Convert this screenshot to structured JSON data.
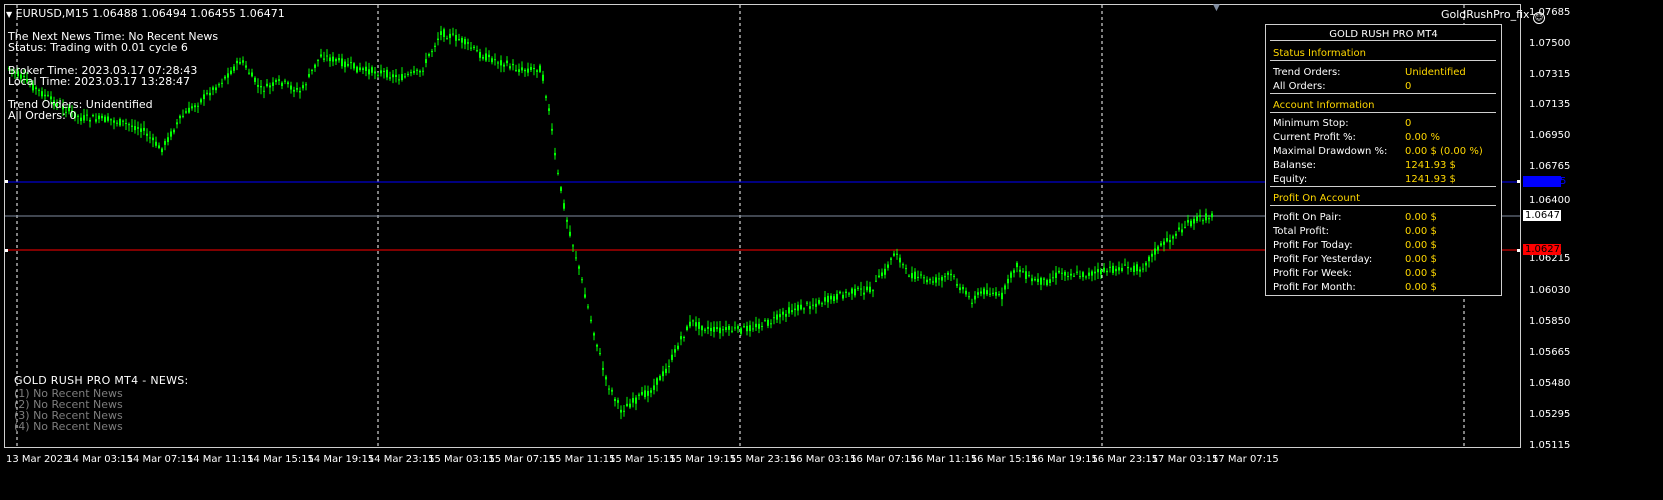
{
  "header": {
    "symbol_info": "EURUSD,M15  1.06488 1.06494 1.06455 1.06471",
    "expert_name": "GoldRushPro_fix"
  },
  "info_block": {
    "line1": "The Next News Time: No Recent News",
    "line2": "Status: Trading with 0.01 cycle 6",
    "line3": "Broker Time: 2023.03.17 07:28:43",
    "line4": "Local Time: 2023.03.17 13:28:47",
    "line5": "Trend Orders: Unidentified",
    "line6": "All Orders: 0"
  },
  "news": {
    "title": "GOLD RUSH PRO MT4 - NEWS:",
    "items": [
      "(1)  No Recent News",
      "(2)  No Recent News",
      "(3)  No Recent News",
      "(4)  No Recent News"
    ]
  },
  "panel": {
    "title": "GOLD RUSH PRO MT4",
    "status_header": "Status Information",
    "trend_orders_label": "Trend Orders:",
    "trend_orders_value": "Unidentified",
    "all_orders_label": "All Orders:",
    "all_orders_value": "0",
    "account_header": "Account Information",
    "min_stop_label": "Minimum Stop:",
    "min_stop_value": "0",
    "current_profit_label": "Current Profit %:",
    "current_profit_value": "0.00 %",
    "max_drawdown_label": "Maximal Drawdown %:",
    "max_drawdown_value": "0.00 $ (0.00 %)",
    "balance_label": "Balanse:",
    "balance_value": "1241.93 $",
    "equity_label": "Equity:",
    "equity_value": "1241.93 $",
    "profit_header": "Profit On Account",
    "profit_pair_label": "Profit On Pair:",
    "profit_pair_value": "0.00 $",
    "total_profit_label": "Total Profit:",
    "total_profit_value": "0.00 $",
    "profit_today_label": "Profit For Today:",
    "profit_today_value": "0.00 $",
    "profit_yesterday_label": "Profit For Yesterday:",
    "profit_yesterday_value": "0.00 $",
    "profit_week_label": "Profit For Week:",
    "profit_week_value": "0.00 $",
    "profit_month_label": "Profit For Month:",
    "profit_month_value": "0.00 $"
  },
  "price_axis": {
    "ticks": [
      "1.07685",
      "1.07500",
      "1.07315",
      "1.07135",
      "1.06950",
      "1.06765",
      "1.06400",
      "1.06215",
      "1.06030",
      "1.05850",
      "1.05665",
      "1.05480",
      "1.05295",
      "1.05115"
    ],
    "current_price": "1.06471",
    "red_line_price": "1.06272",
    "blue_line_price": "1.06675"
  },
  "time_axis": {
    "labels": [
      "13 Mar 2023",
      "14 Mar 03:15",
      "14 Mar 07:15",
      "14 Mar 11:15",
      "14 Mar 15:15",
      "14 Mar 19:15",
      "14 Mar 23:15",
      "15 Mar 03:15",
      "15 Mar 07:15",
      "15 Mar 11:15",
      "15 Mar 15:15",
      "15 Mar 19:15",
      "15 Mar 23:15",
      "16 Mar 03:15",
      "16 Mar 07:15",
      "16 Mar 11:15",
      "16 Mar 15:15",
      "16 Mar 19:15",
      "16 Mar 23:15",
      "17 Mar 03:15",
      "17 Mar 07:15"
    ]
  },
  "colors": {
    "candle": "#00ff00",
    "red_line": "#ff0000",
    "blue_line": "#0000ff",
    "current_line": "#7f8ca0",
    "grid": "#ffffff",
    "accent_text": "#ffd800"
  },
  "icons": {
    "menu": "triangle-down-icon",
    "expert": "smiley-icon",
    "shift": "triangle-down-icon"
  }
}
